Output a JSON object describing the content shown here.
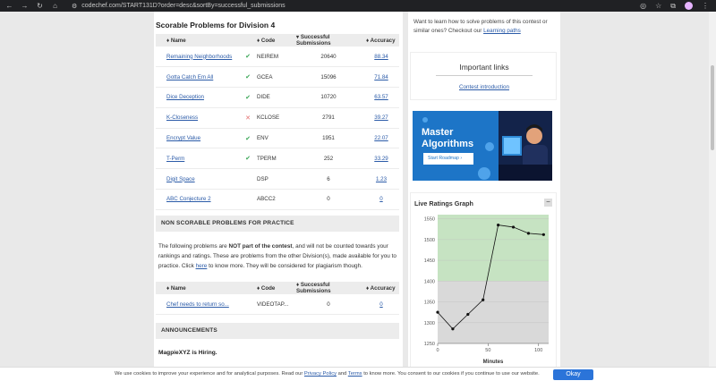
{
  "browser": {
    "url": "codechef.com/START131D?order=desc&sortBy=successful_submissions"
  },
  "scorable": {
    "title": "Scorable Problems for Division 4",
    "headers": {
      "name": "Name",
      "code": "Code",
      "subs": "Successful Submissions",
      "acc": "Accuracy"
    },
    "rows": [
      {
        "name": "Remaining Neighborhoods",
        "status": "solved",
        "code": "NEIREM",
        "subs": "20640",
        "acc": "88.34"
      },
      {
        "name": "Gotta Catch Em All",
        "status": "solved",
        "code": "GCEA",
        "subs": "15096",
        "acc": "71.84"
      },
      {
        "name": "Dice Deception",
        "status": "solved",
        "code": "DIDE",
        "subs": "10720",
        "acc": "63.57"
      },
      {
        "name": "K-Closeness",
        "status": "wrong",
        "code": "KCLOSE",
        "subs": "2791",
        "acc": "39.27"
      },
      {
        "name": "Encrypt Value",
        "status": "solved",
        "code": "ENV",
        "subs": "1951",
        "acc": "22.07"
      },
      {
        "name": "T-Perm",
        "status": "solved",
        "code": "TPERM",
        "subs": "252",
        "acc": "33.29"
      },
      {
        "name": "Digit Space",
        "status": "none",
        "code": "DSP",
        "subs": "6",
        "acc": "1.23"
      },
      {
        "name": "ABC Conjecture 2",
        "status": "none",
        "code": "ABCC2",
        "subs": "0",
        "acc": "0"
      }
    ]
  },
  "non_scorable": {
    "title": "NON SCORABLE PROBLEMS FOR PRACTICE",
    "para_pre": "The following problems are ",
    "para_bold": "NOT part of the contest",
    "para_mid": ", and will not be counted towards your rankings and ratings. These are problems from the other Division(s), made available for you to practice. Click ",
    "para_link": "here",
    "para_post": " to know more. They will be considered for plagiarism though.",
    "headers": {
      "name": "Name",
      "code": "Code",
      "subs": "Successful Submissions",
      "acc": "Accuracy"
    },
    "rows": [
      {
        "name": "Chef needs to return so...",
        "code": "VIDEOTAP...",
        "subs": "0",
        "acc": "0"
      }
    ]
  },
  "announcements": {
    "title": "ANNOUNCEMENTS",
    "first": "MagpieXYZ is Hiring."
  },
  "sidebar": {
    "learn_text": "Want to learn how to solve problems of this contest or similar ones? Checkout our ",
    "learn_link": "Learning paths",
    "important_title": "Important links",
    "important_link": "Contest introduction",
    "banner_line1": "Master",
    "banner_line2": "Algorithms",
    "banner_button": "Start Roadmap  ›"
  },
  "chart_data": {
    "type": "line",
    "title": "Live Ratings Graph",
    "xlabel": "Minutes",
    "ylabel": "",
    "x": [
      0,
      15,
      30,
      45,
      60,
      75,
      90,
      105
    ],
    "y": [
      1325,
      1285,
      1320,
      1355,
      1535,
      1530,
      1515,
      1512
    ],
    "xlim": [
      0,
      110
    ],
    "ylim": [
      1250,
      1560
    ],
    "xticks": [
      0,
      50,
      100
    ],
    "yticks": [
      1250,
      1300,
      1350,
      1400,
      1450,
      1500,
      1550
    ],
    "bands": [
      {
        "from": 1250,
        "to": 1400,
        "color": "#d9d9d9"
      },
      {
        "from": 1400,
        "to": 1560,
        "color": "#c6e3c2"
      }
    ],
    "grid": true
  },
  "cookie": {
    "pre": "We use cookies to improve your experience and for analytical purposes. Read our ",
    "policy": "Privacy Policy",
    "and": " and ",
    "terms": "Terms",
    "post": " to know more. You consent to our cookies if you continue to use our website.",
    "button": "Okay"
  }
}
